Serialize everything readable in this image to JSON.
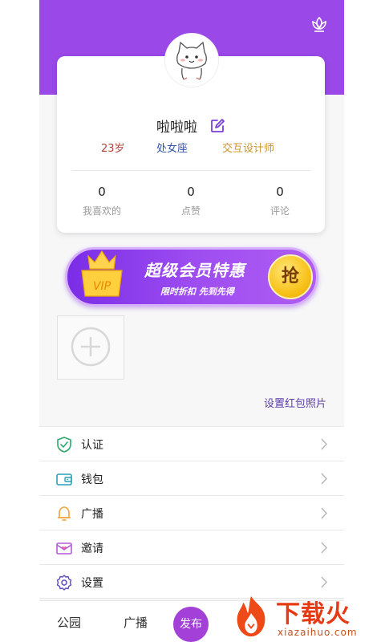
{
  "profile": {
    "name": "啦啦啦",
    "tags": {
      "age": "23岁",
      "zodiac": "处女座",
      "job": "交互设计师"
    },
    "stats": [
      {
        "value": "0",
        "label": "我喜欢的"
      },
      {
        "value": "0",
        "label": "点赞"
      },
      {
        "value": "0",
        "label": "评论"
      }
    ]
  },
  "vip": {
    "badge": "VIP",
    "title": "超级会员特惠",
    "subtitle": "限时折扣 先到先得",
    "grab": "抢"
  },
  "photos": {
    "set_link": "设置红包照片"
  },
  "menu": [
    {
      "label": "认证",
      "icon": "shield-check-icon"
    },
    {
      "label": "钱包",
      "icon": "wallet-icon"
    },
    {
      "label": "广播",
      "icon": "bell-icon"
    },
    {
      "label": "邀请",
      "icon": "envelope-heart-icon"
    },
    {
      "label": "设置",
      "icon": "gear-icon"
    }
  ],
  "tabbar": {
    "park": "公园",
    "broadcast": "广播",
    "publish": "发布"
  },
  "watermark": {
    "brand": "下载火",
    "url": "xiazaihuo.com"
  },
  "colors": {
    "accent": "#9a48e8",
    "vip_gold": "#f8c21b",
    "watermark": "#e63a14"
  }
}
